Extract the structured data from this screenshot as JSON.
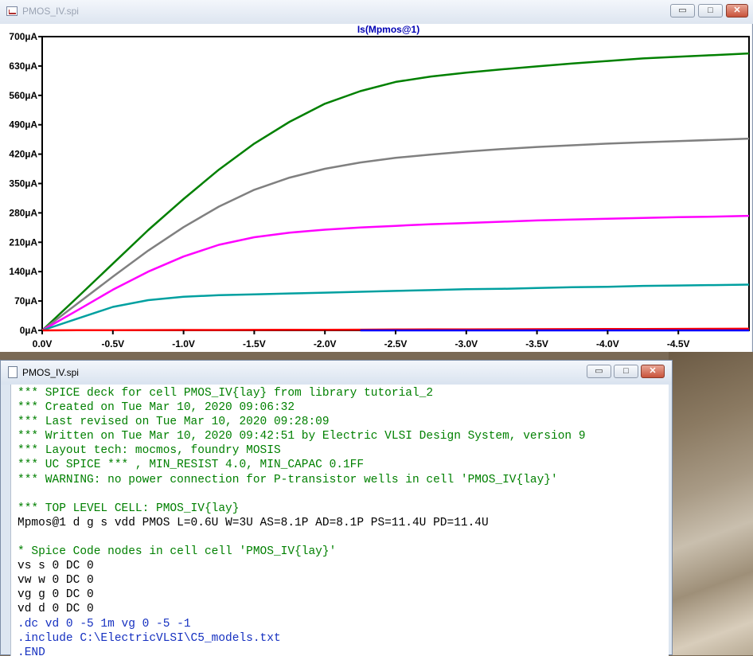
{
  "plot_window": {
    "title": "PMOS_IV.spi",
    "controls": {
      "minimize": "▭",
      "maximize": "□",
      "close": "✕"
    },
    "trace_title": "Is(Mpmos@1)"
  },
  "chart_data": {
    "type": "line",
    "title": "Is(Mpmos@1)",
    "x_tick_labels": [
      "0.0V",
      "-0.5V",
      "-1.0V",
      "-1.5V",
      "-2.0V",
      "-2.5V",
      "-3.0V",
      "-3.5V",
      "-4.0V",
      "-4.5V"
    ],
    "y_tick_labels": [
      "0µA",
      "70µA",
      "140µA",
      "210µA",
      "280µA",
      "350µA",
      "420µA",
      "490µA",
      "560µA",
      "630µA",
      "700µA"
    ],
    "xlim": [
      0,
      -5
    ],
    "ylim": [
      0,
      700
    ],
    "x": [
      0,
      -0.25,
      -0.5,
      -0.75,
      -1.0,
      -1.25,
      -1.5,
      -1.75,
      -2.0,
      -2.25,
      -2.5,
      -2.75,
      -3.0,
      -3.25,
      -3.5,
      -3.75,
      -4.0,
      -4.25,
      -4.5,
      -4.75,
      -5.0
    ],
    "series": [
      {
        "color": "#008000",
        "values": [
          0,
          79,
          159,
          239,
          313,
          383,
          445,
          497,
          540,
          570,
          592,
          605,
          614,
          622,
          629,
          636,
          642,
          648,
          652,
          656,
          660
        ]
      },
      {
        "color": "#808080",
        "values": [
          0,
          64,
          128,
          190,
          246,
          295,
          335,
          364,
          385,
          400,
          411,
          419,
          426,
          432,
          437,
          441,
          445,
          448,
          451,
          454,
          457
        ]
      },
      {
        "color": "#ff00ff",
        "values": [
          0,
          48,
          97,
          140,
          176,
          204,
          222,
          233,
          240,
          245,
          249,
          253,
          256,
          259,
          262,
          264,
          266,
          268,
          270,
          271,
          273
        ]
      },
      {
        "color": "#00a0a0",
        "values": [
          0,
          28,
          56,
          72,
          80,
          84,
          86,
          88,
          90,
          92,
          94,
          96,
          98,
          99,
          101,
          103,
          104,
          106,
          107,
          108,
          109
        ]
      },
      {
        "color": "#ff0000",
        "values": [
          0,
          0.3,
          0.5,
          0.7,
          0.9,
          1.0,
          1.2,
          1.4,
          1.6,
          1.8,
          2.0,
          2.2,
          2.4,
          2.6,
          2.8,
          3.0,
          3.2,
          3.4,
          3.6,
          3.8,
          4.0
        ]
      },
      {
        "color": "#0000ff",
        "values": [
          0,
          0,
          0,
          0,
          0,
          0,
          0,
          0,
          0,
          0,
          0,
          0,
          0,
          0,
          0,
          0,
          0,
          0,
          0,
          0,
          0
        ]
      }
    ],
    "grid": false
  },
  "netlist_window": {
    "title": "PMOS_IV.spi",
    "controls": {
      "minimize": "▭",
      "maximize": "□",
      "close": "✕"
    },
    "lines": [
      {
        "text": "*** SPICE deck for cell PMOS_IV{lay} from library tutorial_2",
        "kind": "comment"
      },
      {
        "text": "*** Created on Tue Mar 10, 2020 09:06:32",
        "kind": "comment"
      },
      {
        "text": "*** Last revised on Tue Mar 10, 2020 09:28:09",
        "kind": "comment"
      },
      {
        "text": "*** Written on Tue Mar 10, 2020 09:42:51 by Electric VLSI Design System, version 9",
        "kind": "comment"
      },
      {
        "text": "*** Layout tech: mocmos, foundry MOSIS",
        "kind": "comment"
      },
      {
        "text": "*** UC SPICE *** , MIN_RESIST 4.0, MIN_CAPAC 0.1FF",
        "kind": "comment"
      },
      {
        "text": "*** WARNING: no power connection for P-transistor wells in cell 'PMOS_IV{lay}'",
        "kind": "comment"
      },
      {
        "text": "",
        "kind": "blank"
      },
      {
        "text": "*** TOP LEVEL CELL: PMOS_IV{lay}",
        "kind": "comment"
      },
      {
        "text": "Mpmos@1 d g s vdd PMOS L=0.6U W=3U AS=8.1P AD=8.1P PS=11.4U PD=11.4U",
        "kind": "statement"
      },
      {
        "text": "",
        "kind": "blank"
      },
      {
        "text": "* Spice Code nodes in cell cell 'PMOS_IV{lay}'",
        "kind": "comment"
      },
      {
        "text": "vs s 0 DC 0",
        "kind": "statement"
      },
      {
        "text": "vw w 0 DC 0",
        "kind": "statement"
      },
      {
        "text": "vg g 0 DC 0",
        "kind": "statement"
      },
      {
        "text": "vd d 0 DC 0",
        "kind": "statement"
      },
      {
        "text": ".dc vd 0 -5 1m vg 0 -5 -1",
        "kind": "directive"
      },
      {
        "text": ".include C:\\ElectricVLSI\\C5_models.txt",
        "kind": "directive"
      },
      {
        "text": ".END",
        "kind": "directive"
      }
    ]
  }
}
